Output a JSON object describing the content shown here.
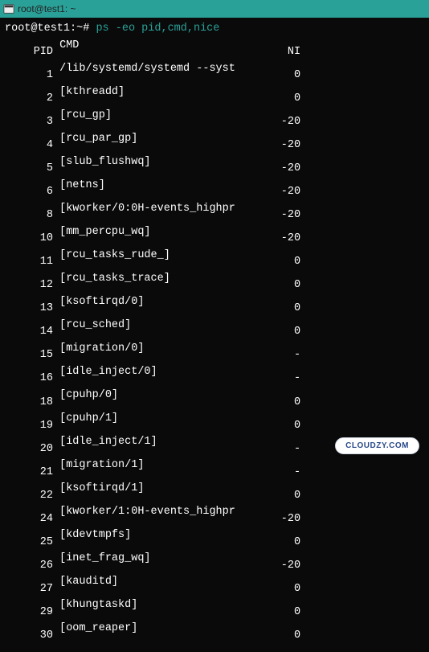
{
  "titlebar": {
    "title": "root@test1: ~"
  },
  "prompt": {
    "user_host": "root@test1:",
    "path": "~",
    "sep": "#",
    "command": "ps -eo pid,cmd,nice"
  },
  "header": {
    "pid": "PID",
    "cmd": "CMD",
    "nice": "NI"
  },
  "rows": [
    {
      "pid": "1",
      "cmd": "/lib/systemd/systemd --syst",
      "nice": "0"
    },
    {
      "pid": "2",
      "cmd": "[kthreadd]",
      "nice": "0"
    },
    {
      "pid": "3",
      "cmd": "[rcu_gp]",
      "nice": "-20"
    },
    {
      "pid": "4",
      "cmd": "[rcu_par_gp]",
      "nice": "-20"
    },
    {
      "pid": "5",
      "cmd": "[slub_flushwq]",
      "nice": "-20"
    },
    {
      "pid": "6",
      "cmd": "[netns]",
      "nice": "-20"
    },
    {
      "pid": "8",
      "cmd": "[kworker/0:0H-events_highpr",
      "nice": "-20"
    },
    {
      "pid": "10",
      "cmd": "[mm_percpu_wq]",
      "nice": "-20"
    },
    {
      "pid": "11",
      "cmd": "[rcu_tasks_rude_]",
      "nice": "0"
    },
    {
      "pid": "12",
      "cmd": "[rcu_tasks_trace]",
      "nice": "0"
    },
    {
      "pid": "13",
      "cmd": "[ksoftirqd/0]",
      "nice": "0"
    },
    {
      "pid": "14",
      "cmd": "[rcu_sched]",
      "nice": "0"
    },
    {
      "pid": "15",
      "cmd": "[migration/0]",
      "nice": "-"
    },
    {
      "pid": "16",
      "cmd": "[idle_inject/0]",
      "nice": "-"
    },
    {
      "pid": "18",
      "cmd": "[cpuhp/0]",
      "nice": "0"
    },
    {
      "pid": "19",
      "cmd": "[cpuhp/1]",
      "nice": "0"
    },
    {
      "pid": "20",
      "cmd": "[idle_inject/1]",
      "nice": "-"
    },
    {
      "pid": "21",
      "cmd": "[migration/1]",
      "nice": "-"
    },
    {
      "pid": "22",
      "cmd": "[ksoftirqd/1]",
      "nice": "0"
    },
    {
      "pid": "24",
      "cmd": "[kworker/1:0H-events_highpr",
      "nice": "-20"
    },
    {
      "pid": "25",
      "cmd": "[kdevtmpfs]",
      "nice": "0"
    },
    {
      "pid": "26",
      "cmd": "[inet_frag_wq]",
      "nice": "-20"
    },
    {
      "pid": "27",
      "cmd": "[kauditd]",
      "nice": "0"
    },
    {
      "pid": "29",
      "cmd": "[khungtaskd]",
      "nice": "0"
    },
    {
      "pid": "30",
      "cmd": "[oom_reaper]",
      "nice": "0"
    }
  ],
  "watermark": {
    "text": "CLOUDZY.COM"
  }
}
